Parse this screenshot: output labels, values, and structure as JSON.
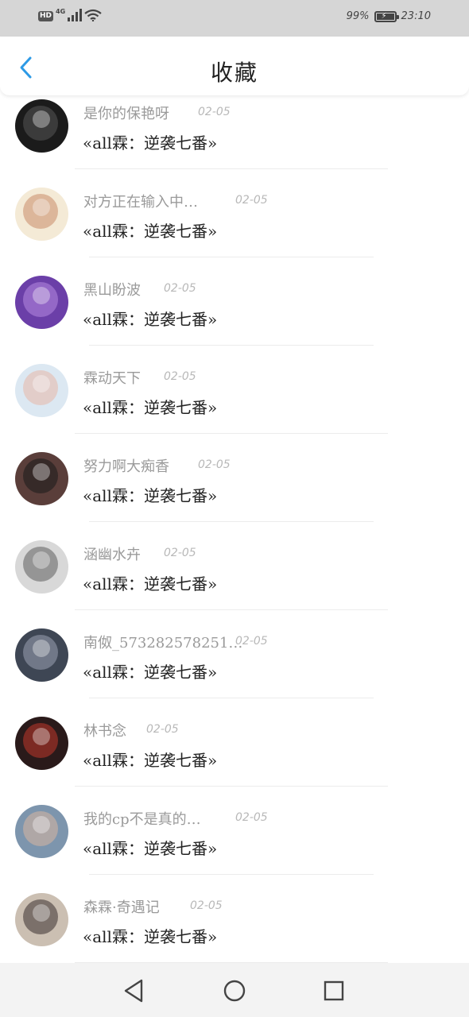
{
  "status_bar": {
    "hd_badge": "HD",
    "network": "4G",
    "battery_text": "99%",
    "battery_level": 0.99,
    "time": "23:10"
  },
  "header": {
    "title": "收藏",
    "back_icon": "chevron-left-icon"
  },
  "colors": {
    "accent": "#2d9ae6",
    "text_primary": "#222222",
    "text_secondary": "#9a9a9a",
    "status_bar_bg": "#d6d6d6"
  },
  "favorites": [
    {
      "user": "是你的保艳呀",
      "date": "02-05",
      "title": "«all霖：逆袭七番»"
    },
    {
      "user": "对方正在输入中…",
      "date": "02-05",
      "title": "«all霖：逆袭七番»"
    },
    {
      "user": "黑山盼波",
      "date": "02-05",
      "title": "«all霖：逆袭七番»"
    },
    {
      "user": "霖动天下",
      "date": "02-05",
      "title": "«all霖：逆袭七番»"
    },
    {
      "user": "努力啊大痴香",
      "date": "02-05",
      "title": "«all霖：逆袭七番»"
    },
    {
      "user": "涵幽水卉",
      "date": "02-05",
      "title": "«all霖：逆袭七番»"
    },
    {
      "user": "南伮_573282578251…",
      "date": "02-05",
      "title": "«all霖：逆袭七番»"
    },
    {
      "user": "林书念",
      "date": "02-05",
      "title": "«all霖：逆袭七番»"
    },
    {
      "user": "我的cp不是真的…",
      "date": "02-05",
      "title": "«all霖：逆袭七番»"
    },
    {
      "user": "森霖·奇遇记",
      "date": "02-05",
      "title": "«all霖：逆袭七番»"
    }
  ],
  "nav_bar": {
    "back": "triangle-back-icon",
    "home": "circle-home-icon",
    "recents": "square-recents-icon"
  }
}
